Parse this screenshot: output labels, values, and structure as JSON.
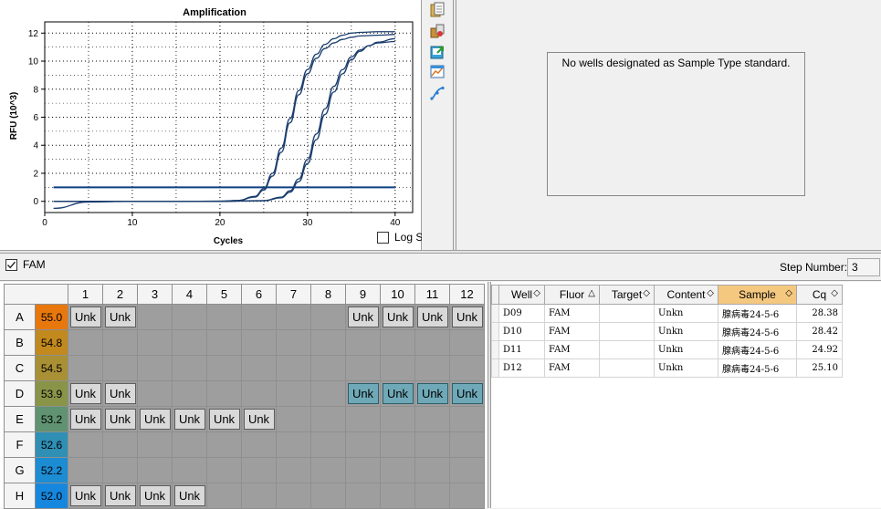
{
  "chart_data": {
    "type": "line",
    "title": "Amplification",
    "xlabel": "Cycles",
    "ylabel": "RFU (10^3)",
    "xlim": [
      0,
      42
    ],
    "ylim": [
      -0.8,
      12.8
    ],
    "xticks": [
      0,
      10,
      20,
      30,
      40
    ],
    "yticks": [
      0,
      2,
      4,
      6,
      8,
      10,
      12
    ],
    "grid": true,
    "threshold": 1.0,
    "series": [
      {
        "x": [
          1,
          5,
          10,
          15,
          20,
          22,
          24,
          25,
          26,
          27,
          28,
          29,
          30,
          31,
          32,
          33,
          34,
          35,
          36,
          38,
          40
        ],
        "y": [
          0.0,
          0.0,
          0.0,
          0.0,
          0.01,
          0.06,
          0.35,
          0.9,
          2.0,
          3.8,
          5.9,
          7.9,
          9.4,
          10.5,
          11.2,
          11.6,
          11.85,
          12.0,
          12.05,
          12.1,
          12.1
        ]
      },
      {
        "x": [
          1,
          5,
          10,
          15,
          20,
          22,
          24,
          25,
          26,
          27,
          28,
          29,
          30,
          31,
          32,
          33,
          34,
          35,
          36,
          38,
          40
        ],
        "y": [
          0.0,
          0.0,
          0.0,
          0.0,
          0.01,
          0.05,
          0.3,
          0.8,
          1.8,
          3.5,
          5.6,
          7.6,
          9.1,
          10.2,
          10.9,
          11.3,
          11.55,
          11.7,
          11.8,
          11.85,
          11.9
        ]
      },
      {
        "x": [
          1,
          5,
          10,
          15,
          20,
          25,
          27,
          28,
          29,
          30,
          31,
          32,
          33,
          34,
          35,
          36,
          37,
          38,
          40
        ],
        "y": [
          -0.5,
          -0.05,
          0.0,
          0.0,
          0.0,
          0.05,
          0.3,
          0.75,
          1.6,
          3.0,
          4.8,
          6.6,
          8.2,
          9.4,
          10.3,
          10.8,
          11.1,
          11.3,
          11.4
        ]
      },
      {
        "x": [
          1,
          5,
          10,
          15,
          20,
          25,
          27,
          28,
          29,
          30,
          31,
          32,
          33,
          34,
          35,
          36,
          37,
          38,
          40
        ],
        "y": [
          0.0,
          0.0,
          0.0,
          0.0,
          0.0,
          0.04,
          0.25,
          0.65,
          1.4,
          2.7,
          4.4,
          6.2,
          7.8,
          9.1,
          10.1,
          10.7,
          11.1,
          11.35,
          11.6
        ]
      }
    ]
  },
  "log_scale_label": "Log Scale",
  "std_message": "No wells designated as Sample Type standard.",
  "fam_label": "FAM",
  "step_number_label": "Step Number:",
  "step_number_value": "3",
  "plate": {
    "columns": [
      "1",
      "2",
      "3",
      "4",
      "5",
      "6",
      "7",
      "8",
      "9",
      "10",
      "11",
      "12"
    ],
    "rows": [
      {
        "label": "A",
        "temp": "55.0",
        "color": "#e8780c",
        "wells": [
          "Unk",
          "Unk",
          "",
          "",
          "",
          "",
          "",
          "",
          "Unk",
          "Unk",
          "Unk",
          "Unk"
        ],
        "sel": [
          0,
          0,
          0,
          0,
          0,
          0,
          0,
          0,
          0,
          0,
          0,
          0
        ]
      },
      {
        "label": "B",
        "temp": "54.8",
        "color": "#c2891f",
        "wells": [
          "",
          "",
          "",
          "",
          "",
          "",
          "",
          "",
          "",
          "",
          "",
          ""
        ],
        "sel": [
          0,
          0,
          0,
          0,
          0,
          0,
          0,
          0,
          0,
          0,
          0,
          0
        ]
      },
      {
        "label": "C",
        "temp": "54.5",
        "color": "#a99035",
        "wells": [
          "",
          "",
          "",
          "",
          "",
          "",
          "",
          "",
          "",
          "",
          "",
          ""
        ],
        "sel": [
          0,
          0,
          0,
          0,
          0,
          0,
          0,
          0,
          0,
          0,
          0,
          0
        ]
      },
      {
        "label": "D",
        "temp": "53.9",
        "color": "#8a9448",
        "wells": [
          "Unk",
          "Unk",
          "",
          "",
          "",
          "",
          "",
          "",
          "Unk",
          "Unk",
          "Unk",
          "Unk"
        ],
        "sel": [
          0,
          0,
          0,
          0,
          0,
          0,
          0,
          0,
          1,
          1,
          1,
          1
        ]
      },
      {
        "label": "E",
        "temp": "53.2",
        "color": "#5f9371",
        "wells": [
          "Unk",
          "Unk",
          "Unk",
          "Unk",
          "Unk",
          "Unk",
          "",
          "",
          "",
          "",
          "",
          ""
        ],
        "sel": [
          0,
          0,
          0,
          0,
          0,
          0,
          0,
          0,
          0,
          0,
          0,
          0
        ]
      },
      {
        "label": "F",
        "temp": "52.6",
        "color": "#2f8fb5",
        "wells": [
          "",
          "",
          "",
          "",
          "",
          "",
          "",
          "",
          "",
          "",
          "",
          ""
        ],
        "sel": [
          0,
          0,
          0,
          0,
          0,
          0,
          0,
          0,
          0,
          0,
          0,
          0
        ]
      },
      {
        "label": "G",
        "temp": "52.2",
        "color": "#1c8cd3",
        "wells": [
          "",
          "",
          "",
          "",
          "",
          "",
          "",
          "",
          "",
          "",
          "",
          ""
        ],
        "sel": [
          0,
          0,
          0,
          0,
          0,
          0,
          0,
          0,
          0,
          0,
          0,
          0
        ]
      },
      {
        "label": "H",
        "temp": "52.0",
        "color": "#1687de",
        "wells": [
          "Unk",
          "Unk",
          "Unk",
          "Unk",
          "",
          "",
          "",
          "",
          "",
          "",
          "",
          ""
        ],
        "sel": [
          0,
          0,
          0,
          0,
          0,
          0,
          0,
          0,
          0,
          0,
          0,
          0
        ]
      }
    ]
  },
  "results": {
    "headers": [
      "Well",
      "Fluor",
      "Target",
      "Content",
      "Sample",
      "Cq"
    ],
    "sort_marks": [
      "◇",
      "△",
      "◇",
      "◇",
      "◇",
      "◇"
    ],
    "rows": [
      [
        "D09",
        "FAM",
        "",
        "Unkn",
        "腺病毒24-5-6",
        "28.38"
      ],
      [
        "D10",
        "FAM",
        "",
        "Unkn",
        "腺病毒24-5-6",
        "28.42"
      ],
      [
        "D11",
        "FAM",
        "",
        "Unkn",
        "腺病毒24-5-6",
        "24.92"
      ],
      [
        "D12",
        "FAM",
        "",
        "Unkn",
        "腺病毒24-5-6",
        "25.10"
      ]
    ]
  },
  "toolbar_icons": [
    "copy-icon",
    "properties-icon",
    "export-icon",
    "zoom-icon",
    "curve-icon"
  ]
}
